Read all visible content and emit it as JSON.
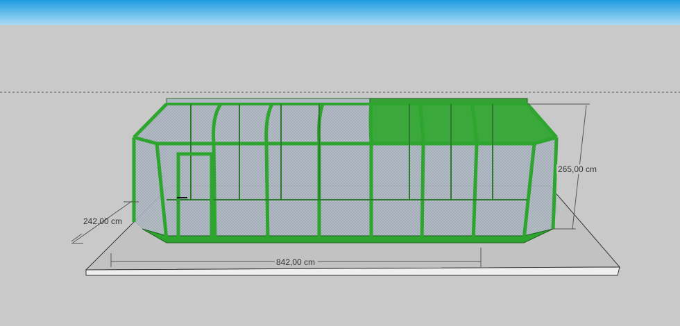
{
  "colors": {
    "sky_top": "#1f9be0",
    "sky_bottom": "#a9dcf5",
    "ground": "#c9c9c9",
    "platform": "#c8c8c8",
    "frame_green": "#2ea52e",
    "glass": "#a6b1bd",
    "roof_panel": "#3aa83a",
    "dimension_line": "#555555"
  },
  "model": {
    "name": "greenhouse-enclosure",
    "bays": 7,
    "covered_roof_bays": 3
  },
  "dimensions": {
    "depth_label": "242,00 cm",
    "length_label": "842,00 cm",
    "height_label": "265,00 cm"
  }
}
